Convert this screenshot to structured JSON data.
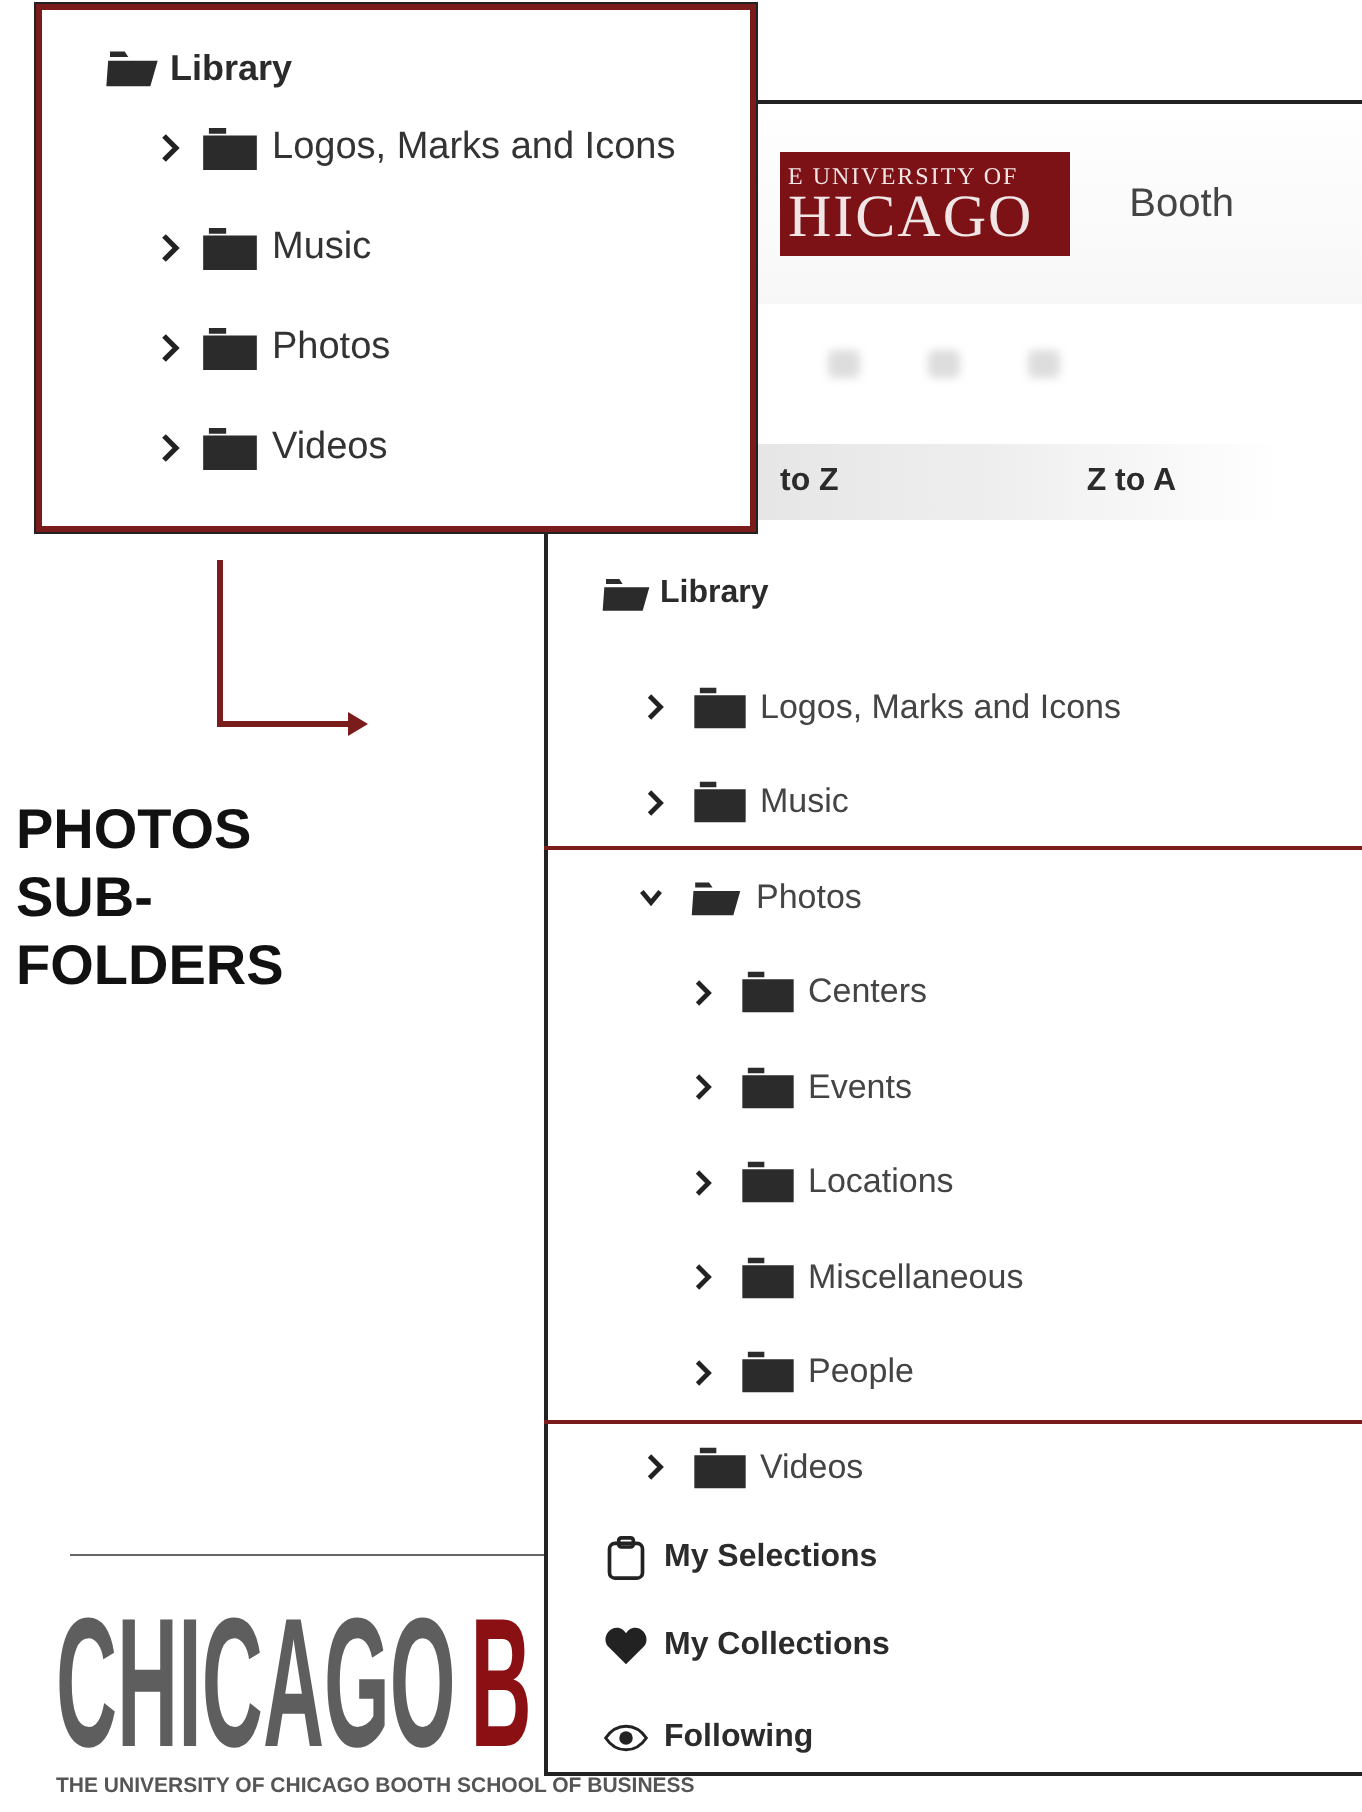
{
  "callout": {
    "tree": {
      "label": "Library",
      "children": [
        {
          "label": "Logos, Marks and Icons",
          "expanded": false
        },
        {
          "label": "Music",
          "expanded": false
        },
        {
          "label": "Photos",
          "expanded": false
        },
        {
          "label": "Videos",
          "expanded": false
        }
      ]
    }
  },
  "caption": "PHOTOS SUB-FOLDERS",
  "app": {
    "logo": {
      "line_1": "E UNIVERSITY OF",
      "line_2": "HICAGO"
    },
    "brand": "Booth",
    "sort_options": [
      "to Z",
      "Z to A"
    ],
    "tree": {
      "label": "Library",
      "children": [
        {
          "label": "Logos, Marks and Icons",
          "expanded": false,
          "highlighted": false
        },
        {
          "label": "Music",
          "expanded": false,
          "highlighted": false
        },
        {
          "label": "Photos",
          "expanded": true,
          "highlighted": true,
          "children": [
            {
              "label": "Centers",
              "expanded": false
            },
            {
              "label": "Events",
              "expanded": false
            },
            {
              "label": "Locations",
              "expanded": false
            },
            {
              "label": "Miscellaneous",
              "expanded": false
            },
            {
              "label": "People",
              "expanded": false
            }
          ]
        },
        {
          "label": "Videos",
          "expanded": false,
          "highlighted": false
        }
      ]
    },
    "menu": [
      {
        "kind": "selections",
        "label": "My Selections"
      },
      {
        "kind": "collections",
        "label": "My Collections"
      },
      {
        "kind": "following",
        "label": "Following"
      }
    ]
  },
  "footer": {
    "wordmark": "CHICAGO",
    "wordmark_accent": "B",
    "tagline": "THE UNIVERSITY OF CHICAGO BOOTH SCHOOL OF BUSINESS"
  }
}
